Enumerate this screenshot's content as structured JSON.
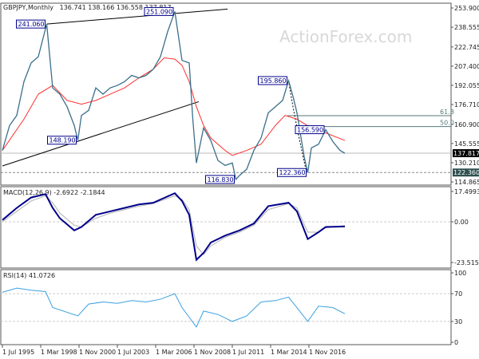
{
  "header": {
    "symbol": "GBPJPY,Monthly",
    "ohlc": "136.741 138.166 136.558 137.817"
  },
  "watermark": "ActionForex.com",
  "macd_label": "MACD(12,26,9) -2.6922 -2.1844",
  "rsi_label": "RSI(14) 41.0726",
  "colors": {
    "price": "#3a6f8a",
    "ma": "#ff3030",
    "macd": "#00008b",
    "signal": "#b0b0b0",
    "rsi": "#3aa0e0",
    "label_border": "#00008b"
  },
  "chart_data": [
    {
      "type": "line",
      "title": "GBPJPY,Monthly",
      "x_ticks": [
        "1 Jul 1995",
        "1 Mar 1998",
        "1 Nov 2000",
        "1 Jul 2003",
        "1 Mar 2006",
        "1 Nov 2008",
        "1 Jul 2011",
        "1 Mar 2014",
        "1 Nov 2016"
      ],
      "x_tick_dates": [
        "1995-07",
        "1998-03",
        "2000-11",
        "2003-07",
        "2006-03",
        "2008-11",
        "2011-07",
        "2014-03",
        "2016-11"
      ],
      "y_ticks": [
        "253.900",
        "238.555",
        "222.745",
        "207.400",
        "192.055",
        "176.710",
        "160.900",
        "145.555",
        "130.210",
        "114.865"
      ],
      "ylim": [
        114.865,
        253.9
      ],
      "last_price": "137.817",
      "support_level": "122.360",
      "price": [
        [
          "1995-07",
          140
        ],
        [
          "1996-01",
          160
        ],
        [
          "1996-07",
          168
        ],
        [
          "1997-01",
          195
        ],
        [
          "1997-07",
          210
        ],
        [
          "1998-01",
          215
        ],
        [
          "1998-08",
          241.06
        ],
        [
          "1999-01",
          190
        ],
        [
          "1999-07",
          185
        ],
        [
          "2000-01",
          175
        ],
        [
          "2000-07",
          160
        ],
        [
          "2000-10",
          148.19
        ],
        [
          "2001-01",
          168
        ],
        [
          "2001-07",
          172
        ],
        [
          "2002-01",
          190
        ],
        [
          "2002-07",
          185
        ],
        [
          "2003-01",
          190
        ],
        [
          "2003-07",
          192
        ],
        [
          "2004-01",
          195
        ],
        [
          "2004-07",
          200
        ],
        [
          "2005-01",
          198
        ],
        [
          "2005-07",
          200
        ],
        [
          "2006-01",
          205
        ],
        [
          "2006-07",
          215
        ],
        [
          "2007-01",
          235
        ],
        [
          "2007-07",
          251.09
        ],
        [
          "2008-01",
          212
        ],
        [
          "2008-07",
          210
        ],
        [
          "2008-10",
          165
        ],
        [
          "2009-01",
          130
        ],
        [
          "2009-07",
          158
        ],
        [
          "2010-01",
          148
        ],
        [
          "2010-07",
          132
        ],
        [
          "2011-01",
          128
        ],
        [
          "2011-07",
          130
        ],
        [
          "2011-10",
          116.83
        ],
        [
          "2012-01",
          120
        ],
        [
          "2012-07",
          125
        ],
        [
          "2013-01",
          140
        ],
        [
          "2013-07",
          150
        ],
        [
          "2014-01",
          170
        ],
        [
          "2014-07",
          175
        ],
        [
          "2015-01",
          180
        ],
        [
          "2015-06",
          195.86
        ],
        [
          "2015-10",
          182
        ],
        [
          "2016-01",
          170
        ],
        [
          "2016-07",
          135
        ],
        [
          "2016-10",
          122.36
        ],
        [
          "2017-01",
          142
        ],
        [
          "2017-07",
          145
        ],
        [
          "2018-01",
          156.59
        ],
        [
          "2018-07",
          147
        ],
        [
          "2019-01",
          140
        ],
        [
          "2019-05",
          137.817
        ]
      ],
      "ma": [
        [
          "1995-07",
          140
        ],
        [
          "1997-01",
          165
        ],
        [
          "1998-01",
          185
        ],
        [
          "1999-01",
          192
        ],
        [
          "2000-01",
          180
        ],
        [
          "2001-01",
          177
        ],
        [
          "2002-01",
          180
        ],
        [
          "2003-01",
          185
        ],
        [
          "2004-01",
          190
        ],
        [
          "2005-01",
          198
        ],
        [
          "2006-01",
          205
        ],
        [
          "2006-10",
          214
        ],
        [
          "2007-07",
          213
        ],
        [
          "2008-01",
          208
        ],
        [
          "2008-07",
          195
        ],
        [
          "2009-01",
          175
        ],
        [
          "2009-07",
          160
        ],
        [
          "2010-01",
          150
        ],
        [
          "2011-01",
          140
        ],
        [
          "2011-07",
          136
        ],
        [
          "2012-07",
          140
        ],
        [
          "2013-07",
          145
        ],
        [
          "2014-07",
          160
        ],
        [
          "2015-03",
          168
        ],
        [
          "2016-01",
          165
        ],
        [
          "2017-01",
          158
        ],
        [
          "2018-01",
          154
        ],
        [
          "2019-05",
          148
        ]
      ],
      "annotations": [
        {
          "text": "241.060",
          "date": "1998-08",
          "value": 241.06
        },
        {
          "text": "251.090",
          "date": "2007-07",
          "value": 251.09
        },
        {
          "text": "148.190",
          "date": "2000-10",
          "value": 148.19
        },
        {
          "text": "116.830",
          "date": "2011-10",
          "value": 116.83
        },
        {
          "text": "195.860",
          "date": "2015-06",
          "value": 195.86
        },
        {
          "text": "156.590",
          "date": "2018-01",
          "value": 156.59
        },
        {
          "text": "122.360",
          "date": "2016-10",
          "value": 122.36
        }
      ],
      "fib_levels": [
        {
          "label": "61.8",
          "value": 167.8
        },
        {
          "label": "50.0",
          "value": 159.1
        }
      ],
      "trendlines": [
        {
          "from": [
            "1998-08",
            241.06
          ],
          "to": [
            "2011-03",
            253
          ]
        },
        {
          "from": [
            "1995-07",
            127.6
          ],
          "to": [
            "2009-03",
            179
          ]
        }
      ]
    },
    {
      "type": "line",
      "title": "MACD(12,26,9)",
      "y_ticks": [
        "17.4993",
        "0.00",
        "-23.5153"
      ],
      "ylim": [
        -23.5153,
        17.4993
      ],
      "macd": [
        [
          "1995-07",
          1
        ],
        [
          "1996-07",
          8
        ],
        [
          "1997-07",
          14
        ],
        [
          "1998-07",
          16
        ],
        [
          "1999-01",
          8
        ],
        [
          "1999-07",
          2
        ],
        [
          "2000-07",
          -5
        ],
        [
          "2001-01",
          -3
        ],
        [
          "2002-01",
          4
        ],
        [
          "2003-01",
          6
        ],
        [
          "2004-01",
          8
        ],
        [
          "2005-01",
          10
        ],
        [
          "2006-01",
          11
        ],
        [
          "2007-07",
          16.5
        ],
        [
          "2008-01",
          12
        ],
        [
          "2008-07",
          4
        ],
        [
          "2009-01",
          -22
        ],
        [
          "2009-07",
          -18
        ],
        [
          "2010-01",
          -12
        ],
        [
          "2011-01",
          -8
        ],
        [
          "2012-01",
          -5
        ],
        [
          "2013-01",
          -1
        ],
        [
          "2014-01",
          9
        ],
        [
          "2015-06",
          11
        ],
        [
          "2016-01",
          6
        ],
        [
          "2016-10",
          -10
        ],
        [
          "2017-07",
          -6
        ],
        [
          "2018-01",
          -3
        ],
        [
          "2019-05",
          -2.6922
        ]
      ],
      "signal": [
        [
          "1995-07",
          0
        ],
        [
          "1996-07",
          6
        ],
        [
          "1997-07",
          12
        ],
        [
          "1998-07",
          15
        ],
        [
          "1999-01",
          11
        ],
        [
          "1999-07",
          5
        ],
        [
          "2000-07",
          -2
        ],
        [
          "2001-01",
          -3
        ],
        [
          "2002-01",
          2
        ],
        [
          "2003-01",
          5
        ],
        [
          "2004-01",
          7
        ],
        [
          "2005-01",
          9
        ],
        [
          "2006-01",
          10.5
        ],
        [
          "2007-07",
          15
        ],
        [
          "2008-01",
          13
        ],
        [
          "2008-07",
          7
        ],
        [
          "2009-01",
          -14
        ],
        [
          "2009-07",
          -19
        ],
        [
          "2010-01",
          -14
        ],
        [
          "2011-01",
          -9
        ],
        [
          "2012-01",
          -6
        ],
        [
          "2013-01",
          -2
        ],
        [
          "2014-01",
          7
        ],
        [
          "2015-06",
          10.5
        ],
        [
          "2016-01",
          8
        ],
        [
          "2016-10",
          -6
        ],
        [
          "2017-07",
          -6
        ],
        [
          "2018-01",
          -3.5
        ],
        [
          "2019-05",
          -2.1844
        ]
      ]
    },
    {
      "type": "line",
      "title": "RSI(14)",
      "y_ticks": [
        "100",
        "70",
        "30",
        "0"
      ],
      "ylim": [
        0,
        100
      ],
      "rsi": [
        [
          "1995-07",
          72
        ],
        [
          "1996-07",
          78
        ],
        [
          "1997-07",
          75
        ],
        [
          "1998-07",
          73
        ],
        [
          "1999-01",
          50
        ],
        [
          "2000-10",
          38
        ],
        [
          "2001-07",
          55
        ],
        [
          "2002-07",
          58
        ],
        [
          "2003-07",
          56
        ],
        [
          "2004-07",
          60
        ],
        [
          "2005-07",
          58
        ],
        [
          "2006-07",
          62
        ],
        [
          "2007-07",
          70
        ],
        [
          "2008-01",
          50
        ],
        [
          "2009-01",
          22
        ],
        [
          "2009-07",
          45
        ],
        [
          "2010-07",
          40
        ],
        [
          "2011-07",
          30
        ],
        [
          "2012-07",
          38
        ],
        [
          "2013-07",
          58
        ],
        [
          "2014-07",
          60
        ],
        [
          "2015-06",
          65
        ],
        [
          "2016-10",
          30
        ],
        [
          "2017-07",
          52
        ],
        [
          "2018-07",
          50
        ],
        [
          "2019-05",
          41.07
        ]
      ]
    }
  ]
}
